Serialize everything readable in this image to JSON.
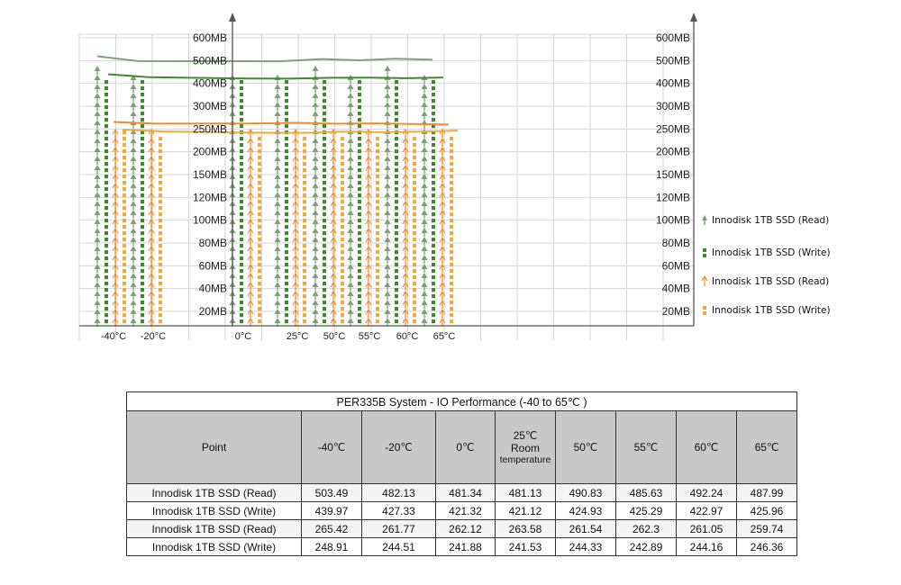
{
  "chart_data": {
    "type": "line+bar",
    "y_ticks": [
      "20MB",
      "40MB",
      "60MB",
      "80MB",
      "100MB",
      "120MB",
      "150MB",
      "200MB",
      "250MB",
      "300MB",
      "400MB",
      "500MB",
      "600MB"
    ],
    "categories": [
      "-40°C",
      "-20°C",
      "0°C",
      "25°C",
      "50°C",
      "55°C",
      "60°C",
      "65°C"
    ],
    "series": [
      {
        "name": "Innodisk 1TB SSD (Read)",
        "color": "#7fa07a",
        "marker": "arrow-green",
        "values": [
          503.49,
          482.13,
          481.34,
          481.13,
          490.83,
          485.63,
          492.24,
          487.99
        ]
      },
      {
        "name": "Innodisk 1TB SSD (Write)",
        "color": "#3f8a2e",
        "marker": "dash-green",
        "values": [
          439.97,
          427.33,
          421.32,
          421.12,
          424.93,
          425.29,
          422.97,
          425.96
        ]
      },
      {
        "name": "Innodisk 1TB SSD (Read)",
        "color": "#f08a2c",
        "marker": "arrow-orange",
        "values": [
          265.42,
          261.77,
          262.12,
          263.58,
          261.54,
          262.3,
          261.05,
          259.74
        ]
      },
      {
        "name": "Innodisk 1TB SSD (Write)",
        "color": "#f2a93b",
        "marker": "dash-orange",
        "values": [
          248.91,
          244.51,
          241.88,
          241.53,
          244.33,
          242.89,
          244.16,
          246.36
        ]
      }
    ]
  },
  "table": {
    "title": "PER335B System - IO Performance (-40 to 65℃ )",
    "headers": [
      "Point",
      "-40℃",
      "-20℃",
      "0℃",
      "25℃",
      "50℃",
      "55℃",
      "60℃",
      "65℃"
    ],
    "header_25_lines": [
      "25℃",
      "Room",
      "temperature"
    ],
    "rows": [
      {
        "label": "Innodisk 1TB SSD (Read)",
        "values": [
          "503.49",
          "482.13",
          "481.34",
          "481.13",
          "490.83",
          "485.63",
          "492.24",
          "487.99"
        ]
      },
      {
        "label": "Innodisk 1TB SSD (Write)",
        "values": [
          "439.97",
          "427.33",
          "421.32",
          "421.12",
          "424.93",
          "425.29",
          "422.97",
          "425.96"
        ]
      },
      {
        "label": "Innodisk 1TB SSD (Read)",
        "values": [
          "265.42",
          "261.77",
          "262.12",
          "263.58",
          "261.54",
          "262.3",
          "261.05",
          "259.74"
        ]
      },
      {
        "label": "Innodisk 1TB SSD (Write)",
        "values": [
          "248.91",
          "244.51",
          "241.88",
          "241.53",
          "244.33",
          "242.89",
          "244.16",
          "246.36"
        ]
      }
    ]
  }
}
